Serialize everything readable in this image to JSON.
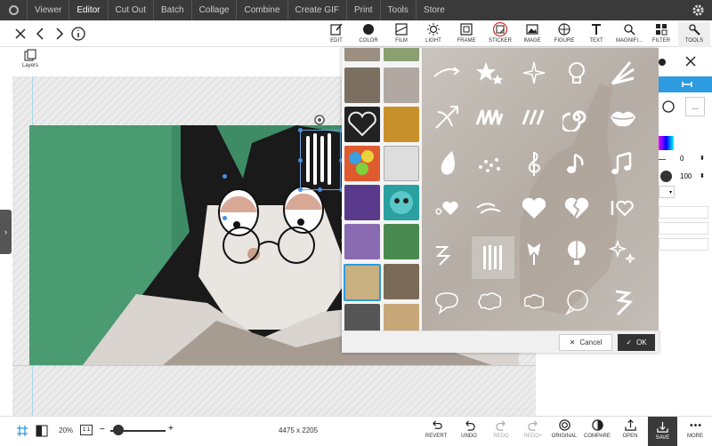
{
  "topnav": {
    "items": [
      "Viewer",
      "Editor",
      "Cut Out",
      "Batch",
      "Collage",
      "Combine",
      "Create GIF",
      "Print",
      "Tools",
      "Store"
    ],
    "active": "Editor"
  },
  "toolbar": {
    "tools": [
      "EDIT",
      "COLOR",
      "FILM",
      "LIGHT",
      "FRAME",
      "STICKER",
      "IMAGE",
      "FIGURE",
      "TEXT",
      "MAGNIFI...",
      "FILTER",
      "TOOLS"
    ]
  },
  "layers": {
    "label": "Layers"
  },
  "sticker_panel": {
    "cancel_label": "Cancel",
    "ok_label": "OK"
  },
  "right_panel": {
    "rotation_value": "0",
    "opacity_value": "100",
    "more_label": "..."
  },
  "bottombar": {
    "zoom": "20%",
    "one_to_one": "1:1",
    "dimensions": "4475 x 2205",
    "actions": [
      "REVERT",
      "UNDO",
      "REDO",
      "REDO+",
      "ORIGINAL",
      "COMPARE",
      "OPEN",
      "SAVE",
      "MORE"
    ]
  },
  "colors": {
    "accent": "#2d9be0",
    "dark": "#3a3a3a",
    "sticker_highlight": "#d9302c"
  }
}
